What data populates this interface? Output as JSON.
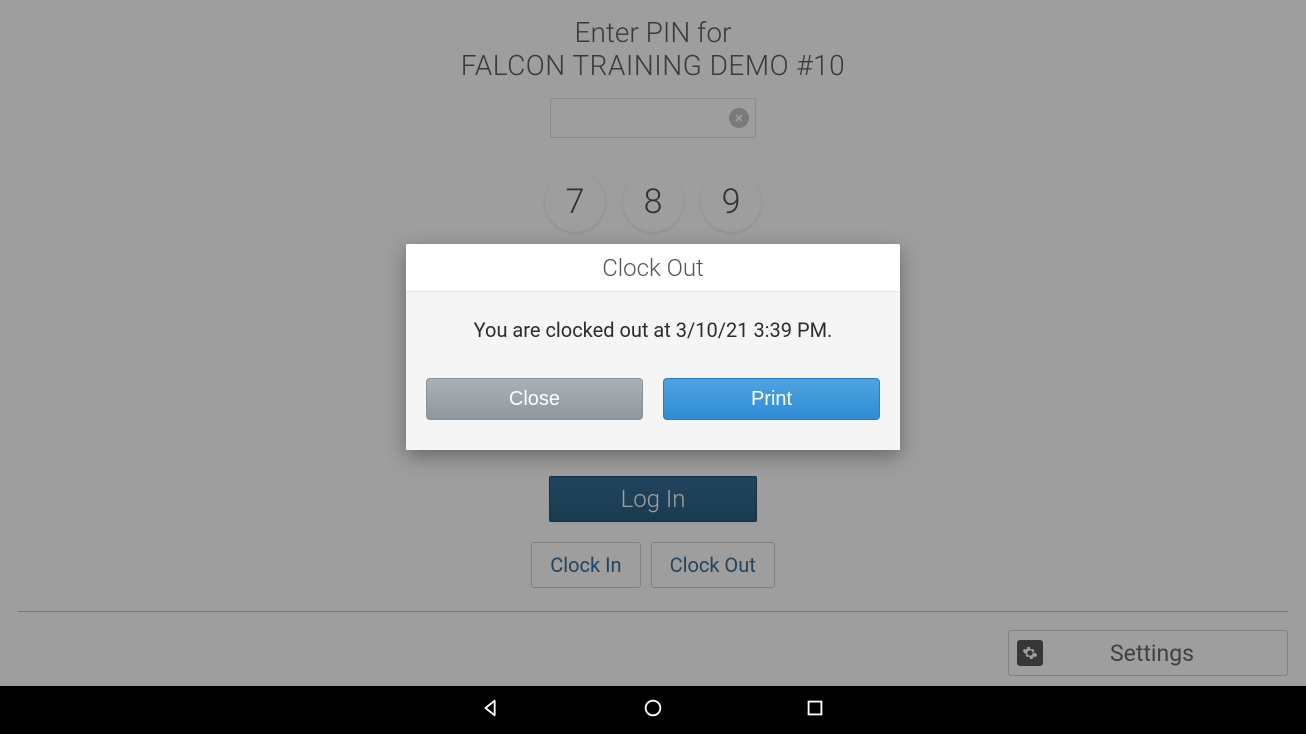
{
  "header": {
    "line1": "Enter PIN for",
    "line2": "FALCON TRAINING DEMO #10"
  },
  "keypad": {
    "row1": [
      "7",
      "8",
      "9"
    ]
  },
  "buttons": {
    "login": "Log In",
    "clock_in": "Clock In",
    "clock_out": "Clock Out",
    "settings": "Settings"
  },
  "modal": {
    "title": "Clock Out",
    "message": "You are clocked out at 3/10/21 3:39 PM.",
    "close": "Close",
    "print": "Print"
  }
}
